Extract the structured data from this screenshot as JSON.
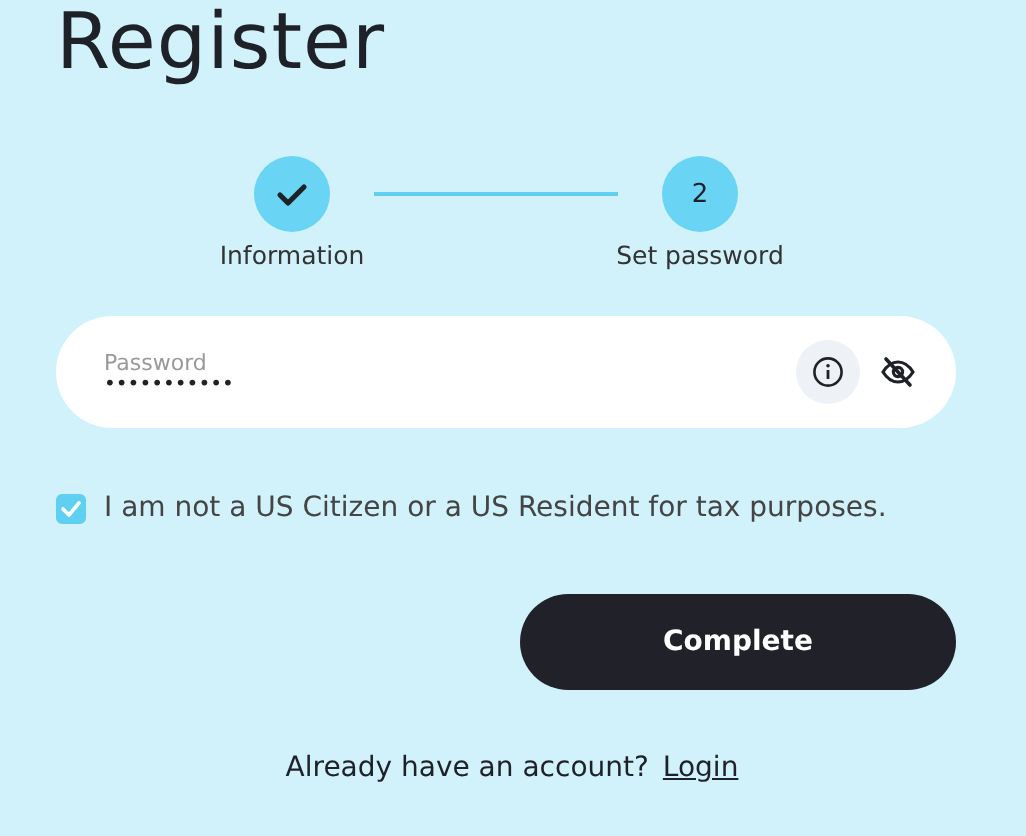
{
  "title": "Register",
  "steps": [
    {
      "label": "Information",
      "done": true
    },
    {
      "label": "Set password",
      "number": "2",
      "done": false
    }
  ],
  "password_field": {
    "label": "Password",
    "value": "•••••••••••",
    "visible": false
  },
  "consent": {
    "label": "I am not a US Citizen or a US Resident for tax purposes.",
    "checked": true
  },
  "submit": "Complete",
  "footer": {
    "text": "Already have an account?",
    "link": "Login"
  }
}
